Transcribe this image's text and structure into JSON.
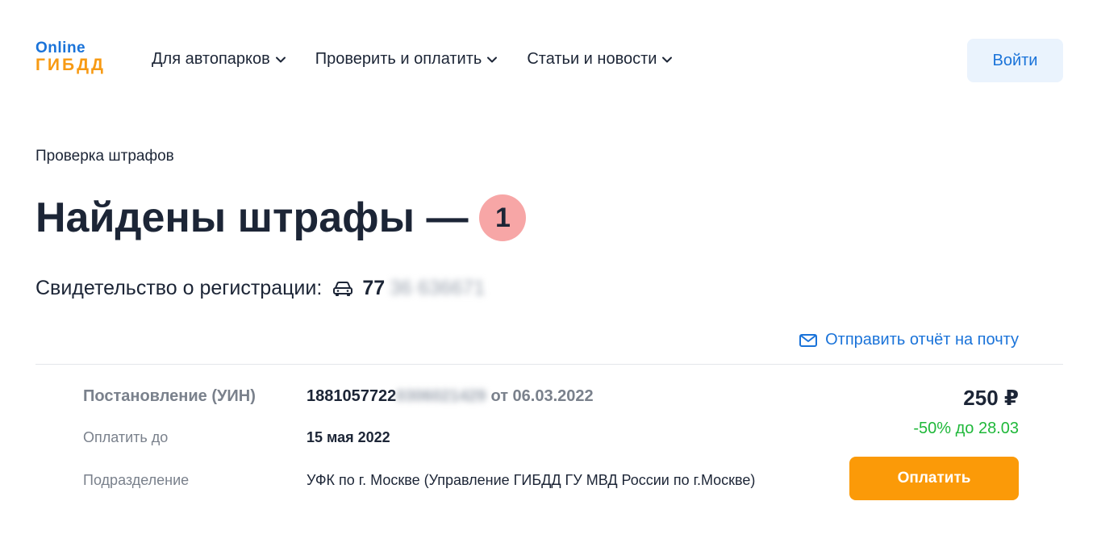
{
  "logo": {
    "line1": "Online",
    "line2": "ГИБДД"
  },
  "nav": {
    "items": [
      {
        "label": "Для автопарков"
      },
      {
        "label": "Проверить и оплатить"
      },
      {
        "label": "Статьи и новости"
      }
    ],
    "login_label": "Войти"
  },
  "breadcrumb": "Проверка штрафов",
  "title": {
    "text": "Найдены штрафы —",
    "count": "1"
  },
  "registration": {
    "label": "Свидетельство о регистрации:",
    "number_prefix": "77",
    "number_hidden": "36 636671"
  },
  "email_link": "Отправить отчёт на почту",
  "fine": {
    "resolution_label": "Постановление (УИН)",
    "resolution_number": "1881057722",
    "resolution_hidden": "0306021429",
    "resolution_date": "от 06.03.2022",
    "pay_until_label": "Оплатить до",
    "pay_until_value": "15 мая 2022",
    "department_label": "Подразделение",
    "department_value": "УФК по г. Москве (Управление ГИБДД ГУ МВД России по г.Москве)",
    "amount": "250 ₽",
    "discount": "-50% до 28.03",
    "pay_label": "Оплатить"
  },
  "colors": {
    "brand_blue": "#1a73d9",
    "brand_orange": "#f79a13",
    "pay_button": "#fb9a08",
    "discount_green": "#1fb83a",
    "badge_red": "#f7a6a6"
  }
}
